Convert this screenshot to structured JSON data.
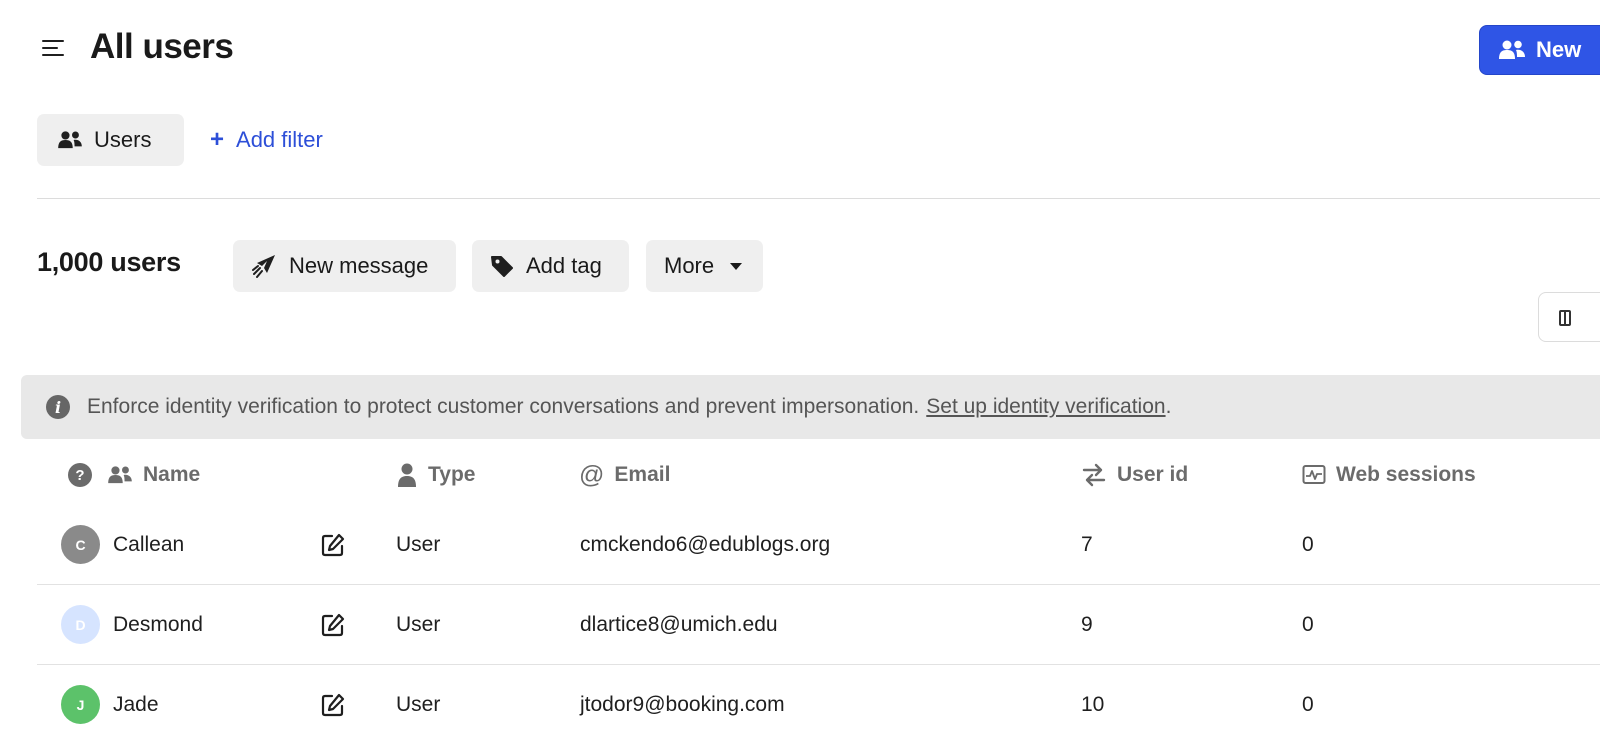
{
  "header": {
    "title": "All users",
    "primary_button_label": "New"
  },
  "filters": {
    "segment_label": "Users",
    "add_filter_label": "Add filter"
  },
  "actions": {
    "count_label": "1,000 users",
    "new_message_label": "New message",
    "add_tag_label": "Add tag",
    "more_label": "More"
  },
  "banner": {
    "text": "Enforce identity verification to protect customer conversations and prevent impersonation.",
    "link_label": "Set up identity verification ",
    "trailing": "."
  },
  "table": {
    "columns": {
      "name": "Name",
      "type": "Type",
      "email": "Email",
      "user_id": "User id",
      "web_sessions": "Web sessions"
    },
    "rows": [
      {
        "initial": "C",
        "name": "Callean",
        "type": "User",
        "email": "cmckendo6@edublogs.org",
        "user_id": "7",
        "web_sessions": "0",
        "avatar_bg": "#8a8a8a",
        "avatar_fg": "#ffffff"
      },
      {
        "initial": "D",
        "name": "Desmond",
        "type": "User",
        "email": "dlartice8@umich.edu",
        "user_id": "9",
        "web_sessions": "0",
        "avatar_bg": "#d6e4ff",
        "avatar_fg": "#ffffff"
      },
      {
        "initial": "J",
        "name": "Jade",
        "type": "User",
        "email": "jtodor9@booking.com",
        "user_id": "10",
        "web_sessions": "0",
        "avatar_bg": "#5cc26a",
        "avatar_fg": "#ffffff"
      }
    ]
  },
  "icons": {
    "menu": "menu-icon",
    "users": "users-icon",
    "plus": "plus-icon",
    "send": "paper-plane-icon",
    "tag": "tag-icon",
    "caret": "caret-down-icon",
    "info": "info-icon",
    "question": "question-icon",
    "person": "person-icon",
    "at": "at-icon",
    "transfer": "arrows-transfer-icon",
    "web": "activity-monitor-icon",
    "edit": "edit-icon",
    "columns": "columns-icon"
  },
  "colors": {
    "accent": "#2f55e6",
    "link": "#2d4fd8",
    "banner_bg": "#e8e8e8",
    "button_bg": "#efefef"
  }
}
